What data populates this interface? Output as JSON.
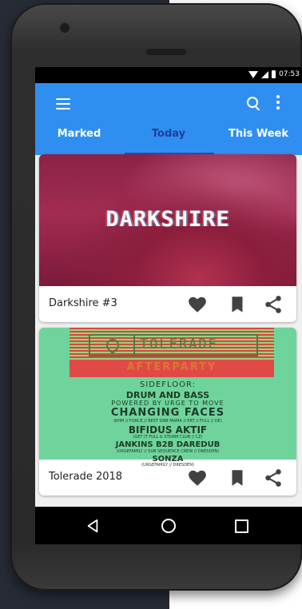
{
  "status_bar": {
    "time": "07:53"
  },
  "tabs": [
    {
      "label": "Marked"
    },
    {
      "label": "Today"
    },
    {
      "label": "This Week"
    }
  ],
  "active_tab": "Today",
  "colors": {
    "app_bar": "#2f8ff0",
    "active_tab_text": "#1e3f9e",
    "indicator": "#1e50c8"
  },
  "events": [
    {
      "title": "Darkshire #3",
      "image_text": "DARKSHIRE"
    },
    {
      "title": "Tolerade 2018",
      "image_text": {
        "brand": "TOLERADE",
        "subtitle": "AFTERPARTY",
        "lines": [
          "SIDEFLOOR:",
          "DRUM AND BASS",
          "POWERED BY URGE TO MOVE",
          "CHANGING FACES",
          "(KHM // FORCE // BEST DNB MAMA // ERT // FULL // DE)",
          "BIFIDUS AKTIF",
          "(GET IT FULL & STORM CLUB // CZ)",
          "JANKINS B2B DAREDUB",
          "(URGEFAMILY // SUB SEQUENCE CREW // DRESDEN)",
          "SONZA",
          "(URGEFAMILY // DRESDEN)"
        ]
      }
    }
  ],
  "icons": {
    "menu": "hamburger-menu-icon",
    "search": "search-icon",
    "more": "more-vert-icon",
    "like": "heart-icon",
    "bookmark": "bookmark-icon",
    "share": "share-icon",
    "back": "back-triangle-icon",
    "home": "home-circle-icon",
    "recents": "recents-square-icon"
  }
}
